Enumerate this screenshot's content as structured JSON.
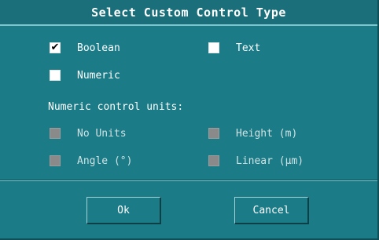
{
  "dialog": {
    "title": "Select Custom Control Type",
    "types": [
      {
        "label": "Boolean",
        "checked": true,
        "glyph": "✔"
      },
      {
        "label": "Text",
        "checked": false,
        "glyph": ""
      },
      {
        "label": "Numeric",
        "checked": false,
        "glyph": ""
      }
    ],
    "units_heading": "Numeric control units:",
    "units": [
      {
        "label": "No Units",
        "enabled": false
      },
      {
        "label": "Height (m)",
        "enabled": false
      },
      {
        "label": "Angle (°)",
        "enabled": false
      },
      {
        "label": "Linear (µm)",
        "enabled": false
      }
    ],
    "ok_label": "Ok",
    "cancel_label": "Cancel"
  }
}
